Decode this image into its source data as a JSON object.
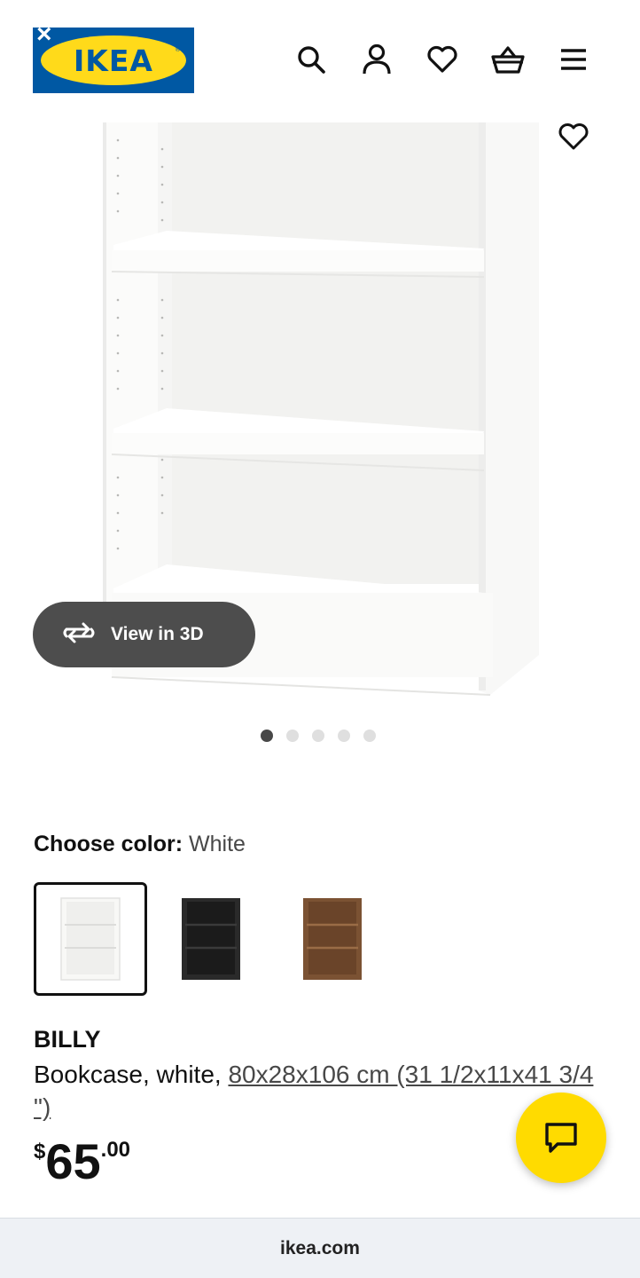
{
  "header": {
    "logo_text": "IKEA",
    "close_label": "×",
    "icons": [
      "search-icon",
      "account-icon",
      "favorites-icon",
      "cart-icon",
      "menu-icon"
    ]
  },
  "gallery": {
    "view3d_label": "View in 3D",
    "dots": 5,
    "active_dot": 0
  },
  "color_choice": {
    "label": "Choose color:",
    "selected": "White",
    "options": [
      {
        "name": "white",
        "color": "#f4f4f2"
      },
      {
        "name": "black-brown",
        "color": "#2a2a2a"
      },
      {
        "name": "brown-walnut",
        "color": "#7b5233"
      }
    ]
  },
  "product": {
    "name": "BILLY",
    "desc_prefix": "Bookcase, white, ",
    "dimensions": "80x28x106 cm (31 1/2x11x41 3/4 \")",
    "price_currency": "$",
    "price_int": "65",
    "price_dec": ".00"
  },
  "browser": {
    "url": "ikea.com"
  },
  "colors": {
    "ikea_blue": "#0058a3",
    "ikea_yellow": "#ffda1a",
    "view3d_bg": "#4d4d4d",
    "chat_yellow": "#ffdb00"
  }
}
